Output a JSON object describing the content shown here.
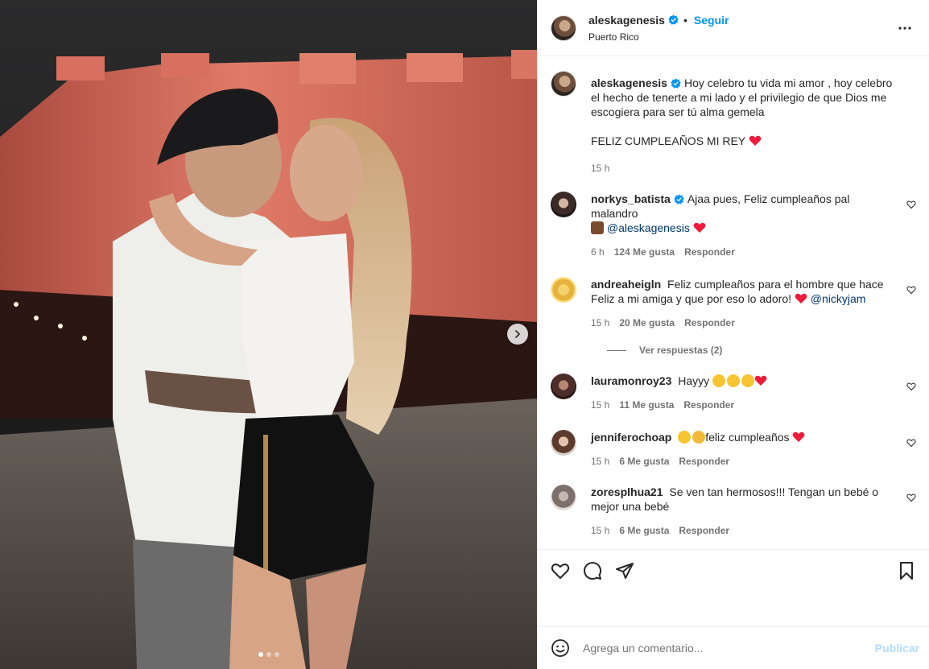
{
  "post": {
    "owner": {
      "username": "aleskagenesis",
      "follow_label": "Seguir",
      "location": "Puerto Rico",
      "separator": "•"
    },
    "media": {
      "next_icon": "chevron-right-icon",
      "slide_count": 3,
      "active_slide": 1
    },
    "caption": {
      "username": "aleskagenesis",
      "text": "Hoy celebro tu vida mi amor , hoy celebro el hecho de tenerte a mi lado y el privilegio de que Dios me escogiera para ser tú alma gemela",
      "text2": "FELIZ CUMPLEAÑOS MI REY",
      "time": "15 h"
    },
    "comments": [
      {
        "username": "norkys_batista",
        "verified": true,
        "text": "Ajaa pues, Feliz cumpleaños pal malandro",
        "mention": "@aleskagenesis",
        "time": "6 h",
        "likes": "124 Me gusta",
        "reply": "Responder"
      },
      {
        "username": "andreaheigln",
        "text": "Feliz cumpleaños para el hombre que hace Feliz a mi amiga y que por eso lo adoro!",
        "mention": "@nickyjam",
        "time": "15 h",
        "likes": "20 Me gusta",
        "reply": "Responder",
        "view_replies": "Ver respuestas (2)"
      },
      {
        "username": "lauramonroy23",
        "text": "Hayyy",
        "time": "15 h",
        "likes": "11 Me gusta",
        "reply": "Responder"
      },
      {
        "username": "jenniferochoap",
        "text": "feliz cumpleaños",
        "time": "15 h",
        "likes": "6 Me gusta",
        "reply": "Responder"
      },
      {
        "username": "zoresplhua21",
        "text": "Se ven tan hermosos!!! Tengan un bebé o mejor una bebé",
        "time": "15 h",
        "likes": "6 Me gusta",
        "reply": "Responder"
      }
    ],
    "actions": {
      "like_icon": "heart-outline-icon",
      "comment_icon": "comment-bubble-icon",
      "share_icon": "paper-plane-icon",
      "save_icon": "bookmark-icon"
    },
    "add_comment": {
      "placeholder": "Agrega un comentario...",
      "publish_label": "Publicar",
      "emoji_icon": "smiley-icon"
    },
    "colors": {
      "accent": "#0095f6",
      "verified": "#0095f6",
      "heart": "#ed1c3c",
      "mention": "#00376b",
      "muted": "#737373"
    }
  }
}
